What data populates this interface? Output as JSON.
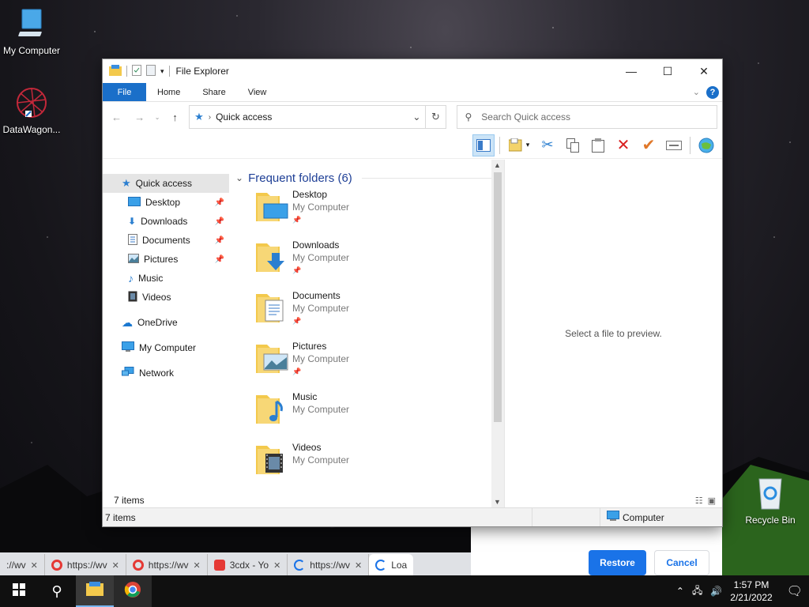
{
  "desktop": {
    "my_computer": "My Computer",
    "datawagon": "DataWagon...",
    "recycle_bin": "Recycle Bin"
  },
  "window": {
    "title": "File Explorer",
    "tabs": {
      "file": "File",
      "home": "Home",
      "share": "Share",
      "view": "View"
    },
    "help": "?",
    "address": "Quick access",
    "search_placeholder": "Search Quick access"
  },
  "sidebar": {
    "items": [
      {
        "label": "Quick access"
      },
      {
        "label": "Desktop"
      },
      {
        "label": "Downloads"
      },
      {
        "label": "Documents"
      },
      {
        "label": "Pictures"
      },
      {
        "label": "Music"
      },
      {
        "label": "Videos"
      },
      {
        "label": "OneDrive"
      },
      {
        "label": "My Computer"
      },
      {
        "label": "Network"
      }
    ]
  },
  "content": {
    "group_title": "Frequent folders (6)",
    "folders": [
      {
        "name": "Desktop",
        "location": "My Computer"
      },
      {
        "name": "Downloads",
        "location": "My Computer"
      },
      {
        "name": "Documents",
        "location": "My Computer"
      },
      {
        "name": "Pictures",
        "location": "My Computer"
      },
      {
        "name": "Music",
        "location": "My Computer"
      },
      {
        "name": "Videos",
        "location": "My Computer"
      }
    ],
    "preview_text": "Select a file to preview.",
    "item_count": "7 items"
  },
  "statusbar": {
    "left": "7 items",
    "right": "Computer"
  },
  "dialog": {
    "restore": "Restore",
    "cancel": "Cancel"
  },
  "browser_tabs": [
    {
      "title": "://wv"
    },
    {
      "title": "https://wv"
    },
    {
      "title": "https://wv"
    },
    {
      "title": "3cdx - Yo"
    },
    {
      "title": "https://wv"
    },
    {
      "title": "Loa"
    }
  ],
  "taskbar": {
    "time": "1:57 PM",
    "date": "2/21/2022"
  },
  "colors": {
    "accent": "#1a6fc9",
    "folder": "#f3c94c",
    "restore_button": "#1a73e8"
  }
}
